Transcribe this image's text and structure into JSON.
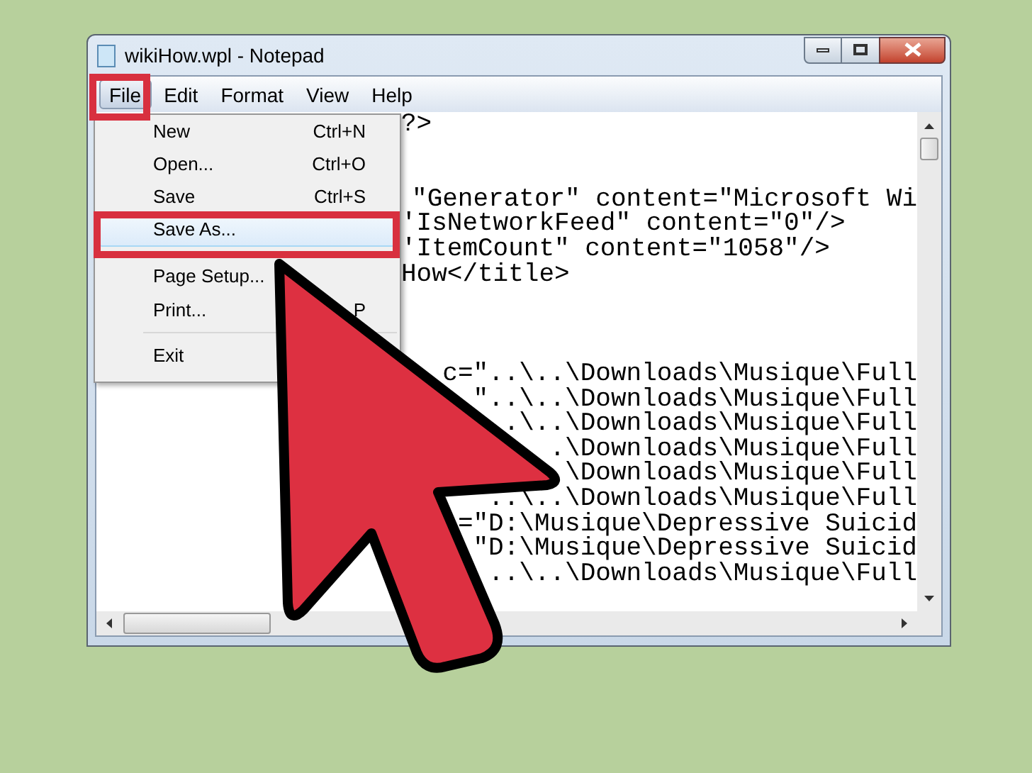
{
  "window": {
    "title": "wikiHow.wpl - Notepad"
  },
  "menu_bar": [
    {
      "label": "File",
      "selected": true
    },
    {
      "label": "Edit",
      "selected": false
    },
    {
      "label": "Format",
      "selected": false
    },
    {
      "label": "View",
      "selected": false
    },
    {
      "label": "Help",
      "selected": false
    }
  ],
  "file_menu": [
    {
      "kind": "item",
      "label": "New",
      "shortcut": "Ctrl+N",
      "selected": false
    },
    {
      "kind": "item",
      "label": "Open...",
      "shortcut": "Ctrl+O",
      "selected": false
    },
    {
      "kind": "item",
      "label": "Save",
      "shortcut": "Ctrl+S",
      "selected": false
    },
    {
      "kind": "item",
      "label": "Save As...",
      "selected": true
    },
    {
      "kind": "separator"
    },
    {
      "kind": "item",
      "label": "Page Setup...",
      "selected": false
    },
    {
      "kind": "item",
      "label": "Print...",
      "shortcut": "P",
      "selected": false
    },
    {
      "kind": "separator"
    },
    {
      "kind": "item",
      "label": "Exit",
      "selected": false
    }
  ],
  "editor": {
    "blocks": [
      {
        "lines": [
          {
            "text": "?>",
            "cut": false
          }
        ]
      },
      {
        "lines": [
          {
            "text": "\"Generator\" content=\"Microsoft Wi",
            "cut": true
          },
          {
            "text": "'IsNetworkFeed\" content=\"0\"/>",
            "cut": false
          },
          {
            "text": "'ItemCount\" content=\"1058\"/>",
            "cut": false
          },
          {
            "text": "How</title>",
            "cut": false
          }
        ]
      },
      {
        "lines": [
          {
            "text": "c=\"..\\..\\Downloads\\Musique\\Full",
            "cut": true
          },
          {
            "text": "\"..\\..\\Downloads\\Musique\\Full",
            "cut": true
          },
          {
            "text": ".\\..\\Downloads\\Musique\\Full",
            "cut": true
          },
          {
            "text": ".\\Downloads\\Musique\\Full",
            "cut": true
          },
          {
            "text": "\\Downloads\\Musique\\Full",
            "cut": true
          },
          {
            "text": "..\\..\\Downloads\\Musique\\Full",
            "cut": true
          },
          {
            "text": "=\"D:\\Musique\\Depressive Suicid",
            "cut": true
          },
          {
            "text": "\"D:\\Musique\\Depressive Suicid",
            "cut": true
          },
          {
            "text": "..\\..\\Downloads\\Musique\\Full",
            "cut": true
          }
        ]
      }
    ]
  }
}
